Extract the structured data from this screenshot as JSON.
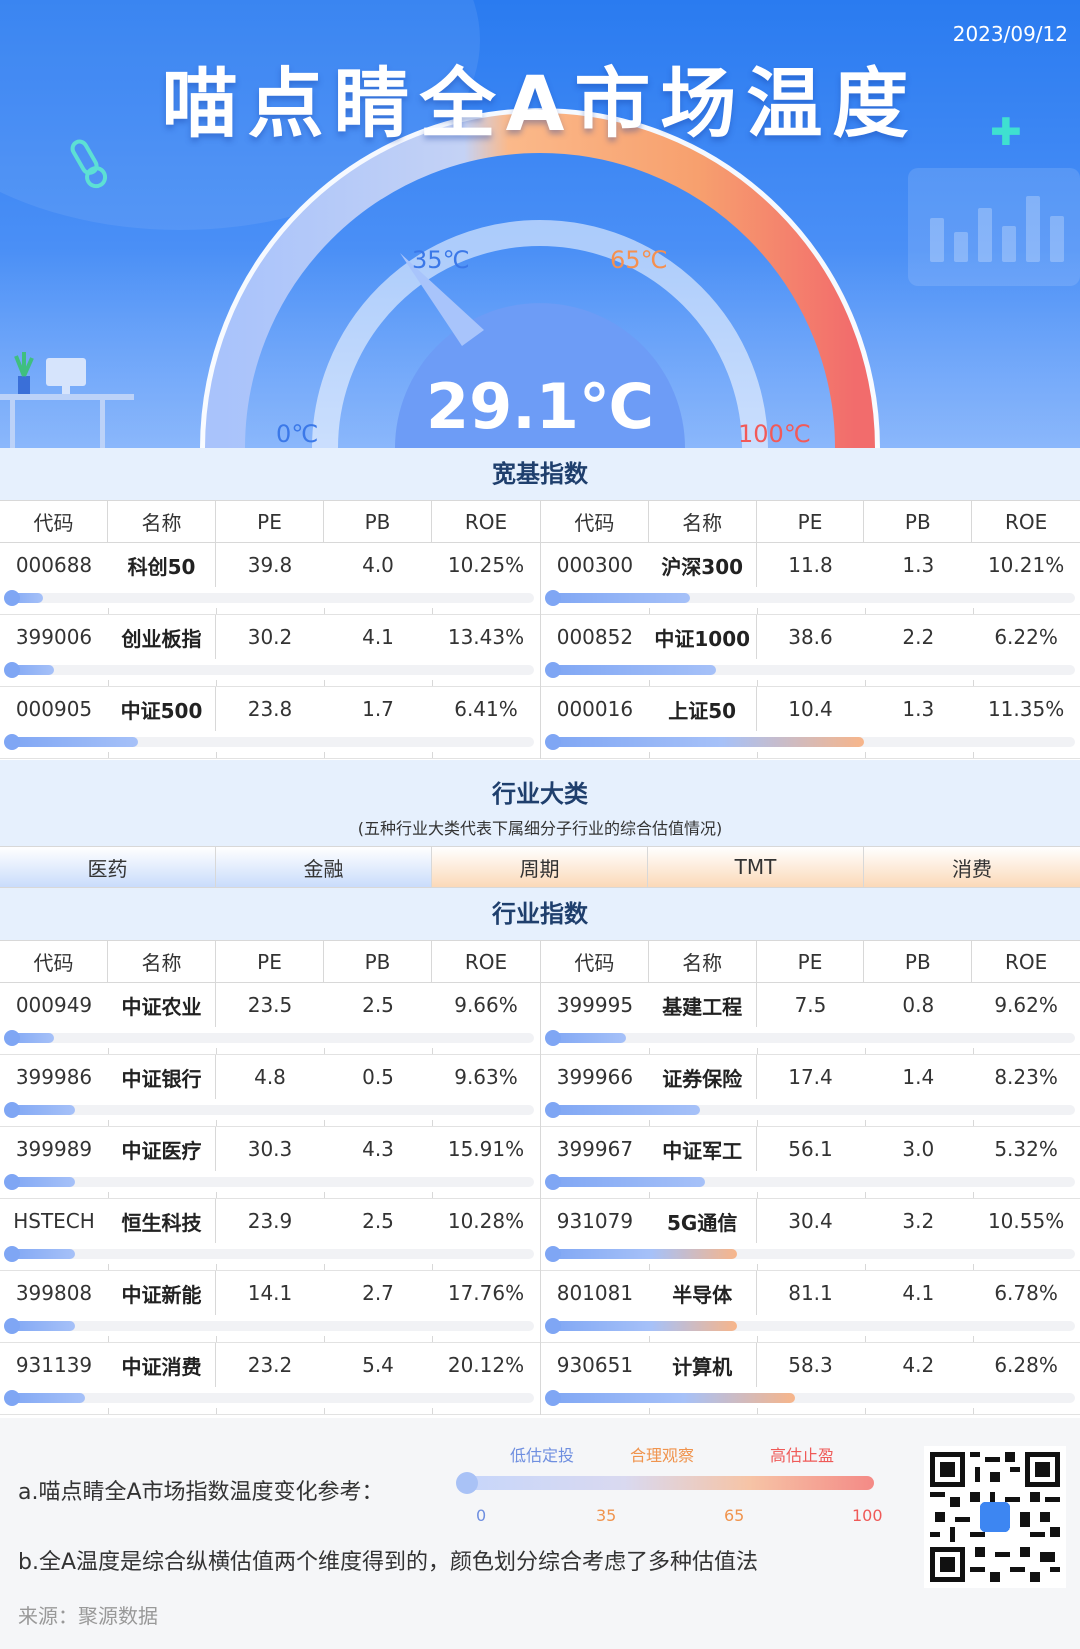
{
  "header": {
    "date": "2023/09/12",
    "title": "喵点睛全A市场温度",
    "temperature": "29.1℃",
    "temperature_value": 29.1,
    "gauge_labels": [
      "0℃",
      "35℃",
      "65℃",
      "100℃"
    ]
  },
  "colors": {
    "primary": "#2a7bf0",
    "low": "#7fa6f4",
    "mid": "#f5a46a",
    "high": "#f2706e"
  },
  "broad": {
    "title": "宽基指数",
    "headers": [
      "代码",
      "名称",
      "PE",
      "PB",
      "ROE"
    ],
    "left": [
      {
        "code": "000688",
        "name": "科创50",
        "pe": "39.8",
        "pb": "4.0",
        "roe": "10.25%",
        "level": 7
      },
      {
        "code": "399006",
        "name": "创业板指",
        "pe": "30.2",
        "pb": "4.1",
        "roe": "13.43%",
        "level": 9
      },
      {
        "code": "000905",
        "name": "中证500",
        "pe": "23.8",
        "pb": "1.7",
        "roe": "6.41%",
        "level": 25
      }
    ],
    "right": [
      {
        "code": "000300",
        "name": "沪深300",
        "pe": "11.8",
        "pb": "1.3",
        "roe": "10.21%",
        "level": 27
      },
      {
        "code": "000852",
        "name": "中证1000",
        "pe": "38.6",
        "pb": "2.2",
        "roe": "6.22%",
        "level": 32
      },
      {
        "code": "000016",
        "name": "上证50",
        "pe": "10.4",
        "pb": "1.3",
        "roe": "11.35%",
        "level": 60
      }
    ]
  },
  "industry_cats": {
    "title": "行业大类",
    "subtitle": "(五种行业大类代表下属细分子行业的综合估值情况)",
    "items": [
      "医药",
      "金融",
      "周期",
      "TMT",
      "消费"
    ]
  },
  "industry": {
    "title": "行业指数",
    "headers": [
      "代码",
      "名称",
      "PE",
      "PB",
      "ROE"
    ],
    "left": [
      {
        "code": "000949",
        "name": "中证农业",
        "pe": "23.5",
        "pb": "2.5",
        "roe": "9.66%",
        "level": 9
      },
      {
        "code": "399986",
        "name": "中证银行",
        "pe": "4.8",
        "pb": "0.5",
        "roe": "9.63%",
        "level": 13
      },
      {
        "code": "399989",
        "name": "中证医疗",
        "pe": "30.3",
        "pb": "4.3",
        "roe": "15.91%",
        "level": 13
      },
      {
        "code": "HSTECH",
        "name": "恒生科技",
        "pe": "23.9",
        "pb": "2.5",
        "roe": "10.28%",
        "level": 13
      },
      {
        "code": "399808",
        "name": "中证新能",
        "pe": "14.1",
        "pb": "2.7",
        "roe": "17.76%",
        "level": 13
      },
      {
        "code": "931139",
        "name": "中证消费",
        "pe": "23.2",
        "pb": "5.4",
        "roe": "20.12%",
        "level": 15
      }
    ],
    "right": [
      {
        "code": "399995",
        "name": "基建工程",
        "pe": "7.5",
        "pb": "0.8",
        "roe": "9.62%",
        "level": 15
      },
      {
        "code": "399966",
        "name": "证券保险",
        "pe": "17.4",
        "pb": "1.4",
        "roe": "8.23%",
        "level": 29
      },
      {
        "code": "399967",
        "name": "中证军工",
        "pe": "56.1",
        "pb": "3.0",
        "roe": "5.32%",
        "level": 30
      },
      {
        "code": "931079",
        "name": "5G通信",
        "pe": "30.4",
        "pb": "3.2",
        "roe": "10.55%",
        "level": 36
      },
      {
        "code": "801081",
        "name": "半导体",
        "pe": "81.1",
        "pb": "4.1",
        "roe": "6.78%",
        "level": 36
      },
      {
        "code": "930651",
        "name": "计算机",
        "pe": "58.3",
        "pb": "4.2",
        "roe": "6.28%",
        "level": 47
      }
    ]
  },
  "footer": {
    "note_a": "a.喵点睛全A市场指数温度变化参考：",
    "note_b": "b.全A温度是综合纵横估值两个维度得到的，颜色划分综合考虑了多种估值法",
    "legend_labels": [
      "低估定投",
      "合理观察",
      "高估止盈"
    ],
    "legend_ticks": [
      "0",
      "35",
      "65",
      "100"
    ],
    "source": "来源：聚源数据"
  }
}
